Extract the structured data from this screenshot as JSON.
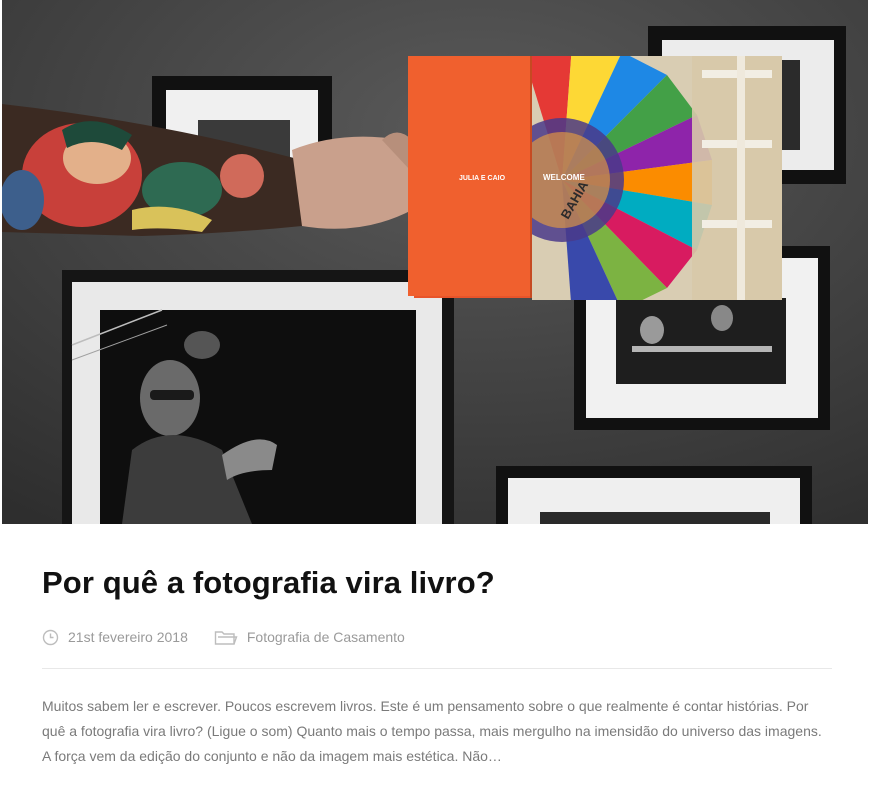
{
  "post": {
    "title": "Por quê a fotografia vira livro?",
    "date": "21st fevereiro 2018",
    "category": "Fotografia de Casamento",
    "excerpt": "Muitos sabem ler e escrever. Poucos escrevem livros. Este é um pensamento sobre o que realmente é contar histórias. Por quê a fotografia vira livro? (Ligue o som) Quanto mais o tempo passa, mais mergulho na imensidão do universo das imagens. A força vem da edição do conjunto e não da imagem mais estética. Não…",
    "icons": {
      "date": "clock-icon",
      "category": "folder-icon"
    }
  },
  "hero_image": {
    "book_spine_text": "JULIA E CAIO",
    "book_cover_word": "WELCOME",
    "book_cover_place": "BAHIA"
  }
}
